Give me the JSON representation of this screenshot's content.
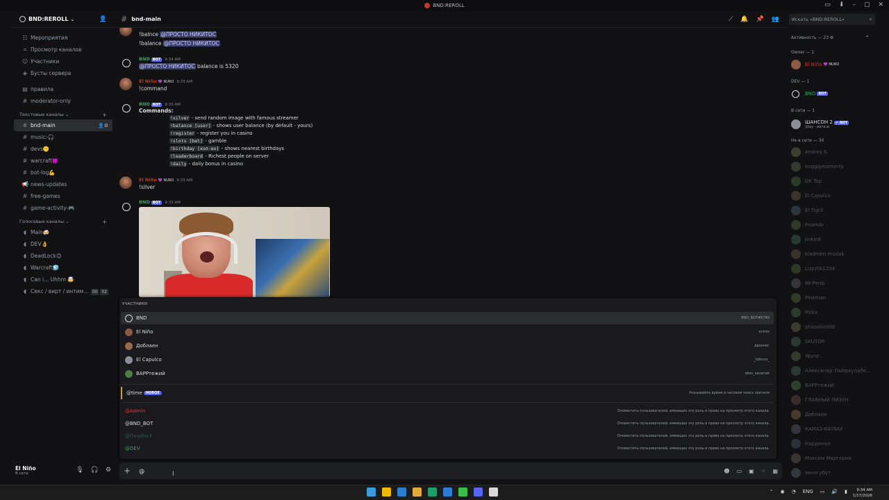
{
  "window": {
    "title": "BND:REROLL",
    "controls": [
      "▭",
      "⬇",
      "–",
      "▢",
      "✕"
    ]
  },
  "server": {
    "name": "BND:REROLL"
  },
  "sidebar": {
    "top_items": [
      {
        "icon": "☷",
        "label": "Мероприятия"
      },
      {
        "icon": "⌗",
        "label": "Просмотр каналов"
      },
      {
        "icon": "☺",
        "label": "Участники"
      },
      {
        "icon": "◈",
        "label": "Бусты сервера"
      }
    ],
    "misc_channels": [
      {
        "label": "правила"
      },
      {
        "label": "moderator-only"
      }
    ],
    "text_category": "Текстовые каналы",
    "text_channels": [
      {
        "label": "bnd-main",
        "active": true
      },
      {
        "label": "music-🎧"
      },
      {
        "label": "devs🤫"
      },
      {
        "label": "warcraft👿"
      },
      {
        "label": "bot-log💪"
      },
      {
        "label": "news-updates"
      },
      {
        "label": "free-games"
      },
      {
        "label": "game-activity-🎮"
      }
    ],
    "voice_category": "Голосовые каналы",
    "voice_channels": [
      {
        "label": "Main🍻"
      },
      {
        "label": "DEV👌"
      },
      {
        "label": "DeadLock😊"
      },
      {
        "label": "Warcraft🧊"
      },
      {
        "label": "Can i... Uhhm 🤯"
      },
      {
        "label": "Секс / вирт / интим..."
      }
    ],
    "voice_badge_a": "00",
    "voice_badge_b": "02"
  },
  "user_panel": {
    "name": "El Niño",
    "status": "В сети"
  },
  "channel": {
    "name": "bnd-main"
  },
  "search": {
    "placeholder": "Искать «BND:REROLL»"
  },
  "messages": {
    "m0_line1_prefix": "!balnce",
    "m0_line1_mention": "@ПРОСТО НИКИТОС",
    "m0_line2_prefix": "!balance",
    "m0_line2_mention": "@ПРОСТО НИКИТОС",
    "m1_name": "BND",
    "m1_tag": "BOT",
    "m1_time": "9:34 AM",
    "m1_mention": "@ПРОСТО НИКИТОС",
    "m1_text": "balance is 5320",
    "m2_name": "El Niño",
    "m2_tag": "💜 NURO",
    "m2_time": "9:33 AM",
    "m2_text": "!command",
    "m3_name": "BND",
    "m3_tag": "BOT",
    "m3_time": "9:33 AM",
    "m3_title": "Commands:",
    "commands": [
      {
        "code": "!silver",
        "desc": " - send random image with famous streamer"
      },
      {
        "code": "!balance [user]",
        "desc": " - shows user balance (by default - yours)"
      },
      {
        "code": "!register",
        "desc": " - register you in casino"
      },
      {
        "code": "!slots [bet]",
        "desc": " - gamble"
      },
      {
        "code": "!birthday [кол-во]",
        "desc": " - shows nearest birthdays"
      },
      {
        "code": "!leaderboard",
        "desc": " - Richest people on server"
      },
      {
        "code": "!daily",
        "desc": " - daily bonus in casino"
      }
    ],
    "m4_name": "El Niño",
    "m4_tag": "💜 NURO",
    "m4_time": "9:33 AM",
    "m4_text": "!silver",
    "m5_name": "BND",
    "m5_tag": "BOT",
    "m5_time": "9:33 AM"
  },
  "popup": {
    "section": "УЧАСТНИКИ",
    "members": [
      {
        "name": "BND",
        "handle": "BND_BOT#6740"
      },
      {
        "name": "El Niño",
        "handle": "erstos"
      },
      {
        "name": "Доблаен",
        "handle": "дроннег"
      },
      {
        "name": "El Capulco",
        "handle": "_tabuun_"
      },
      {
        "name": "ВАРРтежий",
        "handle": "dezz_saverset"
      }
    ],
    "time_label": "@time",
    "time_tag": "НОВОЕ",
    "time_desc": "Указывайте время в часовом поясе зрителя",
    "roles": [
      {
        "name": "@Admin",
        "desc": "Оповестить пользователей, имеющих эту роль и право на просмотр этого канала."
      },
      {
        "name": "@BND_BOT",
        "desc": "Оповестить пользователей, имеющих эту роль и право на просмотр этого канала."
      },
      {
        "name": "@Deadlock",
        "desc": "Оповестить пользователей, имеющих эту роль и право на просмотр этого канала."
      },
      {
        "name": "@DEV",
        "desc": "Оповестить пользователей, имеющих эту роль и право на просмотр этого канала."
      }
    ]
  },
  "composer": {
    "value": "@"
  },
  "member_list": {
    "activity": "Активность — 23 ⚙",
    "owner_group": "Owner — 1",
    "owner": {
      "name": "El Niño",
      "tag": "💜 NURO"
    },
    "dev_group": "DEV — 1",
    "dev": {
      "name": "BND",
      "tag": "BOT"
    },
    "online_group": "В сети — 1",
    "online": {
      "name": "ШАНСОН 2",
      "tag": "✔ BOT",
      "sub": "/play - вита.ю"
    },
    "offline_group": "Не в сети — 30",
    "offline": [
      "Andrey K.",
      "boggipersmerty",
      "DK Top",
      "El Capulco",
      "El Tigr3",
      "FnomAr",
      "jinkin6",
      "kladmen mudak",
      "Lizzz0k1234",
      "Mr.Penis",
      "Pinkman",
      "Piska",
      "shizoiiiiiiddd",
      "SKUTOR",
      "Wurst",
      "Александр Лайфхулдбе...",
      "ВАРРтежий",
      "ГЛАВНЫЙ ЛИЗУН",
      "Доблаен",
      "КАМАЗ-6409АУ",
      "Кардинал",
      "Максим Маргарин",
      "меня убут"
    ]
  },
  "taskbar": {
    "time": "9:34 AM",
    "date": "1/17/2026",
    "lang": "ENG"
  },
  "colors": {
    "accent": "#5865f2",
    "bot_green": "#3ba55c",
    "owner_red": "#c0392b"
  }
}
